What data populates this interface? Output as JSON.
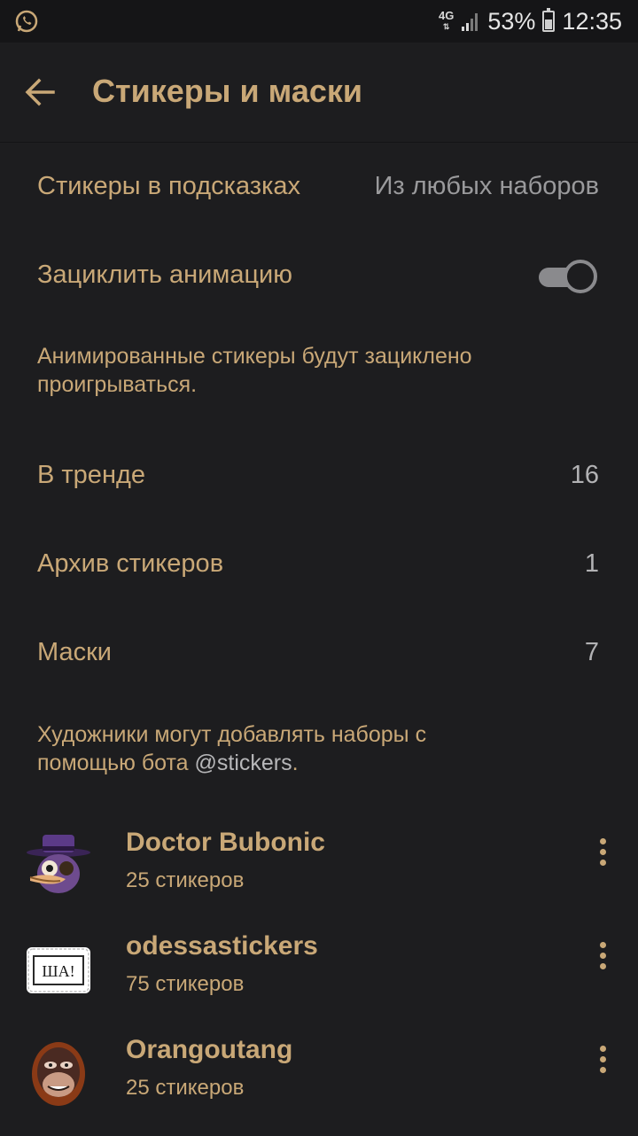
{
  "status_bar": {
    "network_top": "4G",
    "network_bottom": "⇅",
    "battery_percent": "53%",
    "battery_level": 0.53,
    "time": "12:35"
  },
  "header": {
    "title": "Стикеры и маски"
  },
  "settings": {
    "suggestions_label": "Стикеры в подсказках",
    "suggestions_value": "Из любых наборов",
    "loop_label": "Зациклить анимацию",
    "loop_enabled": true,
    "loop_note": "Анимированные стикеры будут зациклено проигрываться."
  },
  "sections": [
    {
      "label": "В тренде",
      "count": "16"
    },
    {
      "label": "Архив стикеров",
      "count": "1"
    },
    {
      "label": "Маски",
      "count": "7"
    }
  ],
  "artists_note": {
    "text": "Художники могут добавлять наборы с помощью бота ",
    "link": "@stickers",
    "end": "."
  },
  "sticker_packs": [
    {
      "name": "Doctor Bubonic",
      "count": "25 стикеров",
      "icon": "plague-doctor-sticker-icon"
    },
    {
      "name": "odessastickers",
      "count": "75 стикеров",
      "icon": "sha-sign-sticker-icon",
      "sticker_text": "ША!"
    },
    {
      "name": "Orangoutang",
      "count": "25 стикеров",
      "icon": "orangutan-sticker-icon"
    }
  ],
  "colors": {
    "background": "#1d1d1f",
    "accent": "#c9a877",
    "secondary_text": "#9a9a9c"
  }
}
